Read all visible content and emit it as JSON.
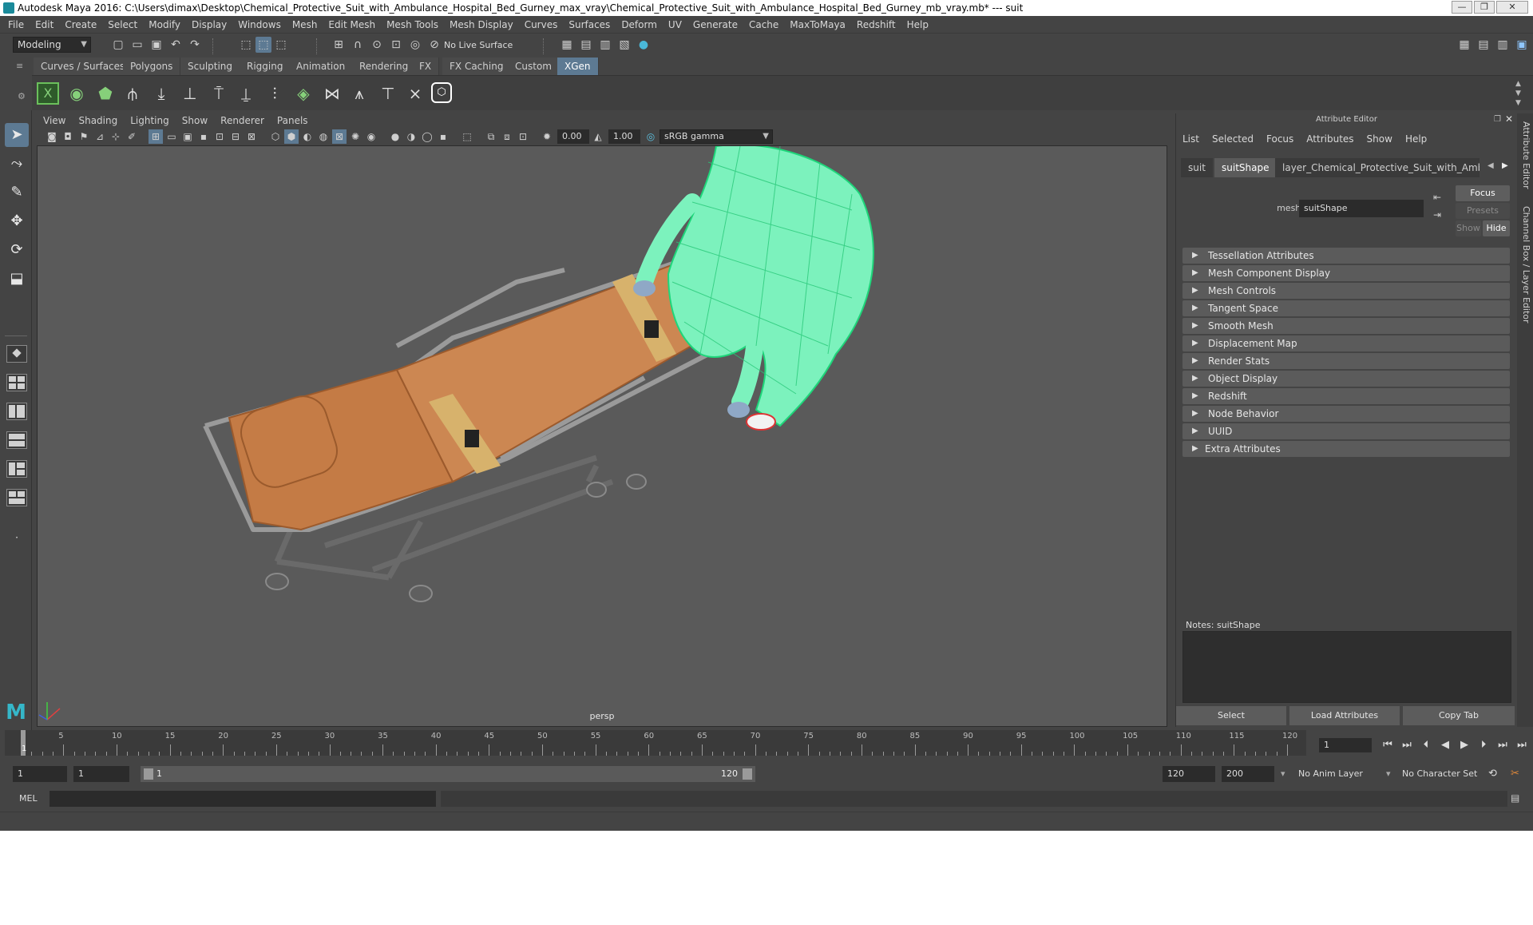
{
  "window": {
    "title": "Autodesk Maya 2016: C:\\Users\\dimax\\Desktop\\Chemical_Protective_Suit_with_Ambulance_Hospital_Bed_Gurney_max_vray\\Chemical_Protective_Suit_with_Ambulance_Hospital_Bed_Gurney_mb_vray.mb*   ---   suit",
    "controls": [
      "—",
      "❐",
      "✕"
    ]
  },
  "menubar": [
    "File",
    "Edit",
    "Create",
    "Select",
    "Modify",
    "Display",
    "Windows",
    "Mesh",
    "Edit Mesh",
    "Mesh Tools",
    "Mesh Display",
    "Curves",
    "Surfaces",
    "Deform",
    "UV",
    "Generate",
    "Cache",
    "MaxToMaya",
    "Redshift",
    "Help"
  ],
  "statusline": {
    "mode": "Modeling",
    "live_surface": "No Live Surface"
  },
  "shelf": {
    "tabs": [
      "Curves / Surfaces",
      "Polygons",
      "Sculpting",
      "Rigging",
      "Animation",
      "Rendering",
      "FX",
      "FX Caching",
      "Custom",
      "XGen"
    ],
    "selected_tab": "XGen",
    "icons": [
      "xgen-icon",
      "xgen-preview-icon",
      "xgen-description-icon",
      "xgen-guide-icon",
      "xgen-add-guide-icon",
      "xgen-sculpt-icon",
      "xgen-length-icon",
      "xgen-bend-icon",
      "xgen-lock-icon",
      "xgen-comb-icon",
      "xgen-layer-icon",
      "xgen-attract-icon",
      "xgen-clump-icon",
      "xgen-noise-icon",
      "xgen-cut-icon",
      "xgen-hex-icon"
    ]
  },
  "viewport": {
    "menu": [
      "View",
      "Shading",
      "Lighting",
      "Show",
      "Renderer",
      "Panels"
    ],
    "exposure": "0.00",
    "gamma": "1.00",
    "color_space": "sRGB gamma",
    "camera_label": "persp"
  },
  "attribute_editor": {
    "title": "Attribute Editor",
    "menu": [
      "List",
      "Selected",
      "Focus",
      "Attributes",
      "Show",
      "Help"
    ],
    "tabs": [
      "suit",
      "suitShape",
      "layer_Chemical_Protective_Suit_with_Ambulance_H"
    ],
    "selected_tab": "suitShape",
    "mesh_label": "mesh:",
    "mesh_value": "suitShape",
    "focus_button": "Focus",
    "presets_button": "Presets",
    "show_button": "Show",
    "hide_button": "Hide",
    "sections": [
      "Tessellation Attributes",
      "Mesh Component Display",
      "Mesh Controls",
      "Tangent Space",
      "Smooth Mesh",
      "Displacement Map",
      "Render Stats",
      "Object Display",
      "Redshift",
      "Node Behavior",
      "UUID",
      "Extra Attributes"
    ],
    "notes_label": "Notes:  suitShape",
    "bottom_buttons": [
      "Select",
      "Load Attributes",
      "Copy Tab"
    ]
  },
  "side_tabs": [
    "Attribute Editor",
    "Channel Box / Layer Editor"
  ],
  "timeline": {
    "ticks": [
      "5",
      "10",
      "15",
      "20",
      "25",
      "30",
      "35",
      "40",
      "45",
      "50",
      "55",
      "60",
      "65",
      "70",
      "75",
      "80",
      "85",
      "90",
      "95",
      "100",
      "105",
      "110",
      "115",
      "120"
    ],
    "start_label": "1",
    "current_frame": "1"
  },
  "range": {
    "start": "1",
    "anim_start": "1",
    "range_start": "1",
    "range_end": "120",
    "end": "120",
    "anim_end": "200",
    "anim_layer": "No Anim Layer",
    "character_set": "No Character Set"
  },
  "command_line": {
    "language": "MEL"
  },
  "colors": {
    "accent": "#5d7a93",
    "background": "#444444",
    "viewport": "#5a5a5a",
    "gurney_pad": "#c98552",
    "suit_wire": "#5ff0a0"
  }
}
